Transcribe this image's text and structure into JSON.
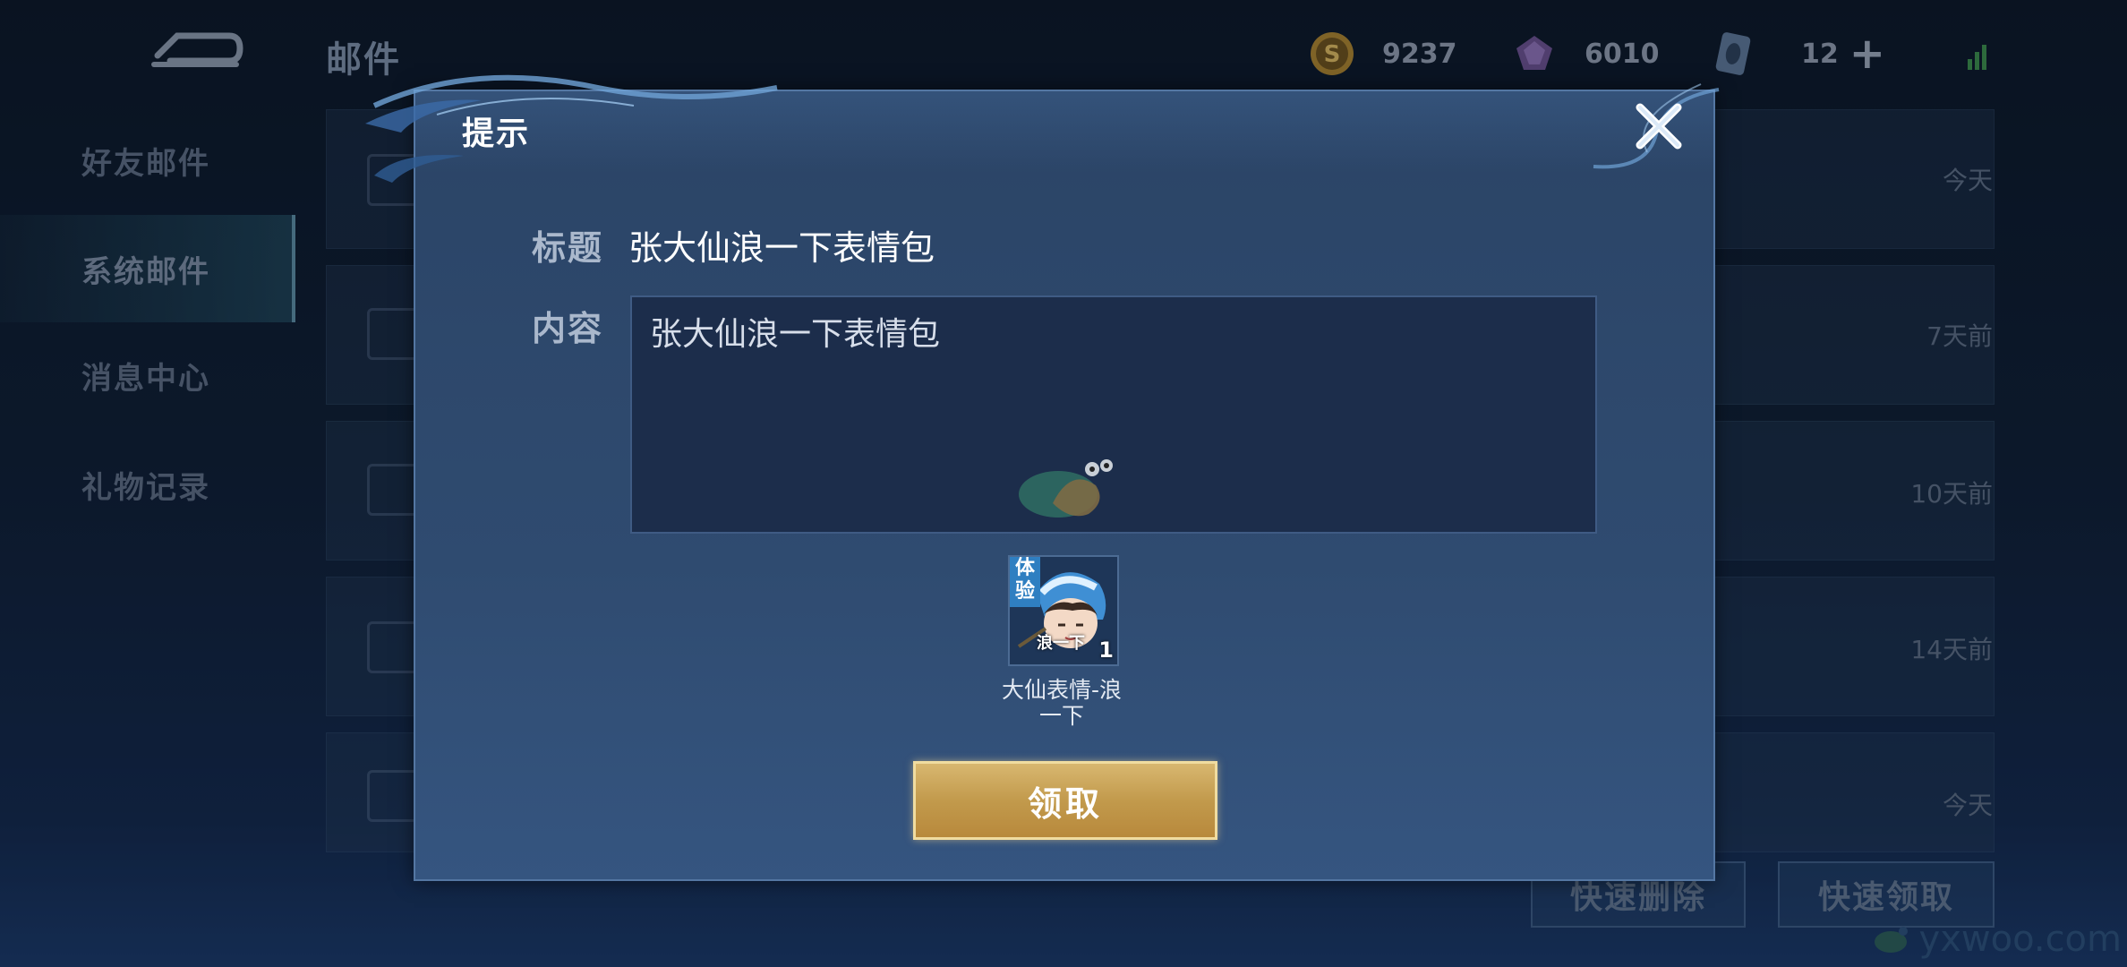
{
  "header": {
    "title": "邮件",
    "currencies": [
      {
        "name": "gold-coin",
        "value": "9237"
      },
      {
        "name": "diamond",
        "value": "6010"
      },
      {
        "name": "ticket",
        "value": "12"
      }
    ]
  },
  "sidebar": {
    "items": [
      {
        "label": "好友邮件",
        "active": false
      },
      {
        "label": "系统邮件",
        "active": true
      },
      {
        "label": "消息中心",
        "active": false
      },
      {
        "label": "礼物记录",
        "active": false
      }
    ]
  },
  "mail_list": {
    "rows": [
      {
        "date": "今天"
      },
      {
        "date": "7天前"
      },
      {
        "date": "10天前"
      },
      {
        "date": "14天前"
      },
      {
        "date": "今天"
      }
    ]
  },
  "bottom_buttons": {
    "quick_delete": "快速删除",
    "quick_claim": "快速领取"
  },
  "dialog": {
    "title": "提示",
    "title_label": "标题",
    "title_value": "张大仙浪一下表情包",
    "content_label": "内容",
    "content_value": "张大仙浪一下表情包",
    "reward": {
      "tag": "体验",
      "face_label": "浪一下",
      "count": "1",
      "name_line1": "大仙表情-浪",
      "name_line2": "一下"
    },
    "claim_label": "领取"
  },
  "watermark": {
    "text": "yxwoo.com"
  },
  "colors": {
    "dialog_bg": "#2f4b70",
    "content_box": "#1c2d4b",
    "claim_gold": "#c29a4c"
  }
}
